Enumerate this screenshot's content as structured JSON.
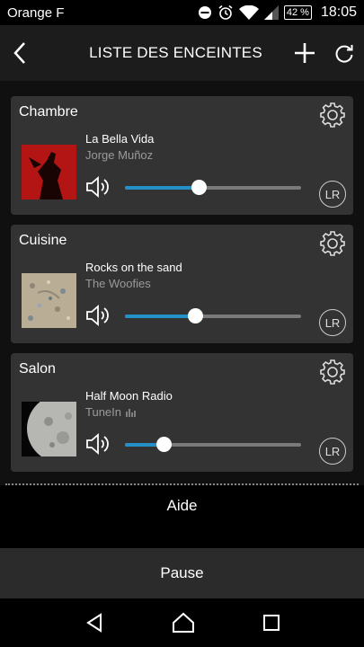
{
  "status": {
    "carrier": "Orange F",
    "battery": "42 %",
    "time": "18:05",
    "icons": [
      "do-not-disturb-icon",
      "alarm-icon",
      "wifi-icon",
      "signal-icon",
      "battery-icon"
    ]
  },
  "header": {
    "title": "LISTE DES ENCEINTES",
    "icons": [
      "back-arrow-icon",
      "plus-icon",
      "refresh-icon"
    ]
  },
  "speakers": [
    {
      "name": "Chambre",
      "track": "La Bella Vida",
      "artist": "Jorge Muñoz",
      "volume": 0.42,
      "channel": "LR",
      "cover": "red-silhouette"
    },
    {
      "name": "Cuisine",
      "track": "Rocks on the sand",
      "artist": "The Woofies",
      "volume": 0.4,
      "channel": "LR",
      "cover": "sand-stones"
    },
    {
      "name": "Salon",
      "track": "Half Moon Radio",
      "artist": "TuneIn",
      "artist_icon": "tunein-bars-icon",
      "volume": 0.22,
      "channel": "LR",
      "cover": "moon"
    }
  ],
  "footer": {
    "help_label": "Aide",
    "pause_label": "Pause"
  },
  "navbar": {
    "icons": [
      "back-triangle-icon",
      "home-icon",
      "recents-icon"
    ]
  },
  "colors": {
    "accent": "#2590c8",
    "card": "#333333",
    "header": "#1c1c1c"
  }
}
